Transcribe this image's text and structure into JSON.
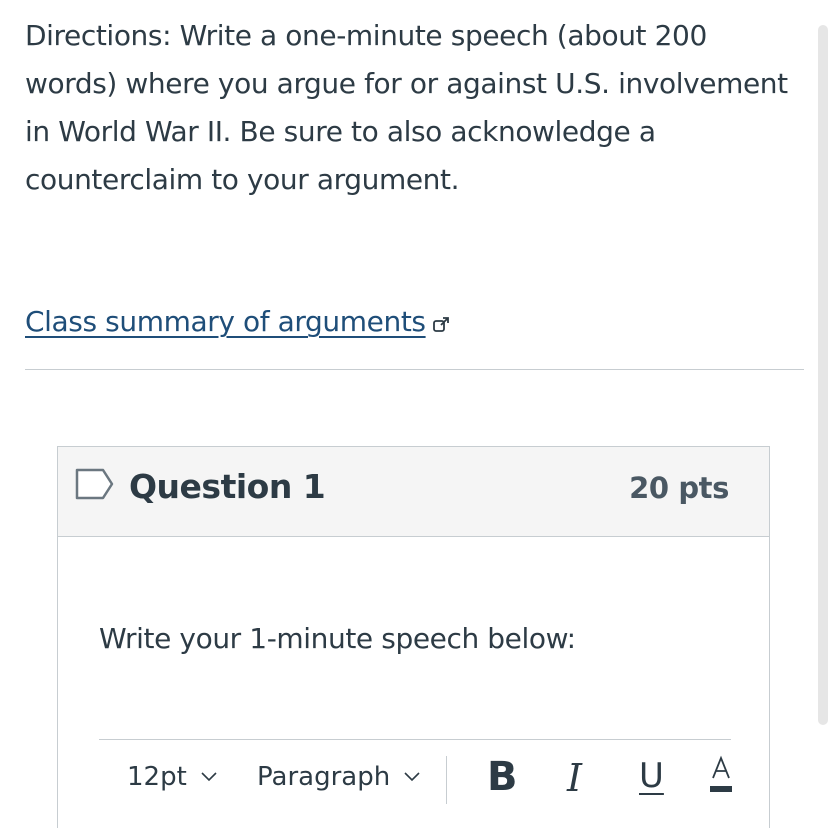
{
  "directions": {
    "text": "Directions: Write a one-minute speech (about 200 words) where you argue for or against U.S. involvement in World War II. Be sure to also acknowledge a counterclaim to your argument."
  },
  "summary_link": {
    "label": "Class summary of arguments",
    "icon": "external-link-icon"
  },
  "question": {
    "title": "Question 1",
    "points": "20 pts",
    "flag_icon": "bookmark-flag-icon",
    "prompt": "Write your 1-minute speech below:"
  },
  "toolbar": {
    "font_size": "12pt",
    "block_format": "Paragraph",
    "bold_label": "B",
    "italic_label": "I",
    "underline_label": "U",
    "font_color_label": "A",
    "chevron_icon": "chevron-down-icon"
  },
  "colors": {
    "text": "#2d3b45",
    "link": "#1f4e79",
    "border": "#c7cdd1",
    "header_bg": "#f5f5f5"
  }
}
